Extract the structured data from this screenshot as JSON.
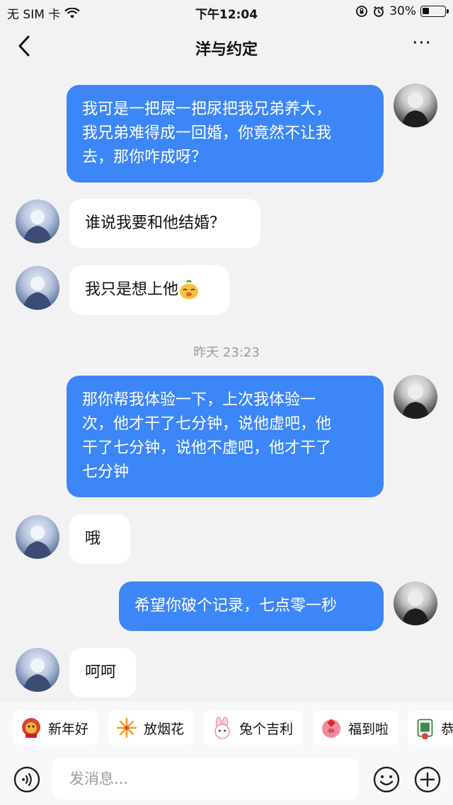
{
  "status_bar": {
    "carrier": "无 SIM 卡",
    "time": "下午12:04",
    "battery_percent": "30%",
    "battery_level": 0.3
  },
  "header": {
    "title": "洋与约定",
    "more": "···"
  },
  "messages": [
    {
      "sender": "me",
      "text": "我可是一把屎一把尿把我兄弟养大，\n我兄弟难得成一回婚，你竟然不让我\n去，那你咋成呀？"
    },
    {
      "sender": "them",
      "text": "谁说我要和他结婚？"
    },
    {
      "sender": "them",
      "text": "我只是想上他",
      "emoji": "sly-face-sticker"
    },
    {
      "sender": "me",
      "text": "那你帮我体验一下，上次我体验一\n次，他才干了七分钟，说他虚吧，他\n干了七分钟，说他不虚吧，他才干了\n七分钟"
    },
    {
      "sender": "them",
      "text": "哦"
    },
    {
      "sender": "me",
      "text": "希望你破个记录，七点零一秒"
    },
    {
      "sender": "them",
      "text": "呵呵"
    }
  ],
  "timestamp": "昨天 23:23",
  "quick_replies": [
    {
      "label": "新年好",
      "icon": "lion-mascot-icon"
    },
    {
      "label": "放烟花",
      "icon": "fireworks-icon"
    },
    {
      "label": "兔个吉利",
      "icon": "rabbit-icon"
    },
    {
      "label": "福到啦",
      "icon": "pig-lucky-icon"
    },
    {
      "label": "恭",
      "icon": "mahjong-icon"
    }
  ],
  "input": {
    "placeholder": "发消息..."
  },
  "colors": {
    "my_bubble": "#3d86f7",
    "their_bubble": "#ffffff",
    "background": "#f2f2f4"
  }
}
